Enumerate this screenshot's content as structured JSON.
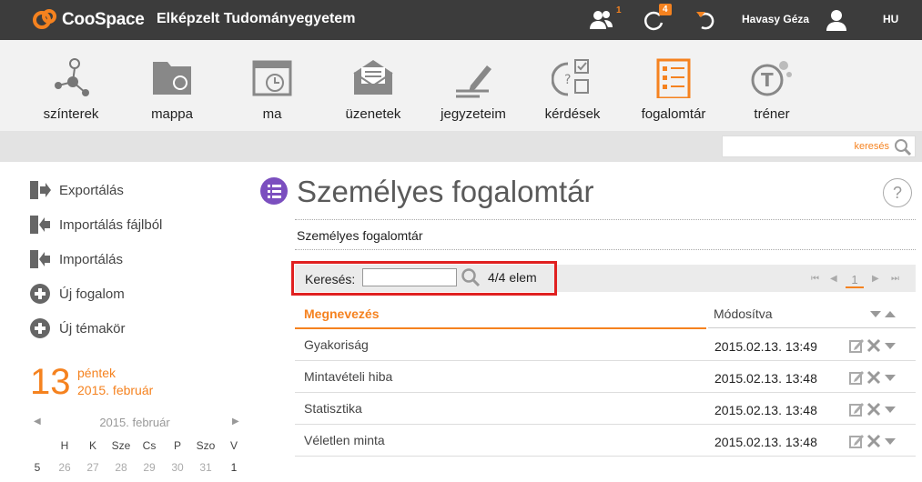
{
  "app": {
    "name": "CooSpace",
    "institution": "Elképzelt Tudományegyetem",
    "user": "Havasy Géza",
    "language": "HU",
    "badges": {
      "people": "1",
      "activity": "4"
    }
  },
  "modules": [
    {
      "label": "színterek",
      "icon": "network-icon"
    },
    {
      "label": "mappa",
      "icon": "folder-icon"
    },
    {
      "label": "ma",
      "icon": "calendar-clock-icon"
    },
    {
      "label": "üzenetek",
      "icon": "envelope-icon"
    },
    {
      "label": "jegyzeteim",
      "icon": "pencil-icon"
    },
    {
      "label": "kérdések",
      "icon": "question-checklist-icon"
    },
    {
      "label": "fogalomtár",
      "icon": "glossary-icon",
      "active": true
    },
    {
      "label": "tréner",
      "icon": "trainer-icon"
    }
  ],
  "global_search": {
    "placeholder": "keresés"
  },
  "sidebar": {
    "actions": [
      {
        "label": "Exportálás",
        "icon": "export-icon"
      },
      {
        "label": "Importálás fájlból",
        "icon": "import-file-icon"
      },
      {
        "label": "Importálás",
        "icon": "import-icon"
      },
      {
        "label": "Új fogalom",
        "icon": "plus-circle-icon"
      },
      {
        "label": "Új témakör",
        "icon": "plus-circle-icon"
      }
    ],
    "calendar": {
      "day": "13",
      "weekday": "péntek",
      "month_label": "2015. február",
      "title": "2015. február",
      "weekdays": [
        "H",
        "K",
        "Sze",
        "Cs",
        "P",
        "Szo",
        "V"
      ],
      "week_number": "5",
      "days": [
        "26",
        "27",
        "28",
        "29",
        "30",
        "31",
        "1"
      ]
    }
  },
  "main": {
    "title": "Személyes fogalomtár",
    "subtitle": "Személyes fogalomtár",
    "search_label": "Keresés:",
    "search_value": "",
    "count": "4/4 elem",
    "page": "1",
    "columns": {
      "name": "Megnevezés",
      "modified": "Módosítva"
    },
    "rows": [
      {
        "name": "Gyakoriság",
        "modified": "2015.02.13. 13:49"
      },
      {
        "name": "Mintavételi hiba",
        "modified": "2015.02.13. 13:48"
      },
      {
        "name": "Statisztika",
        "modified": "2015.02.13. 13:48"
      },
      {
        "name": "Véletlen minta",
        "modified": "2015.02.13. 13:48"
      }
    ]
  },
  "colors": {
    "accent": "#f5821f",
    "topbar": "#3c3c3c",
    "highlight": "#e02020",
    "title_icon": "#7b4fbf"
  }
}
